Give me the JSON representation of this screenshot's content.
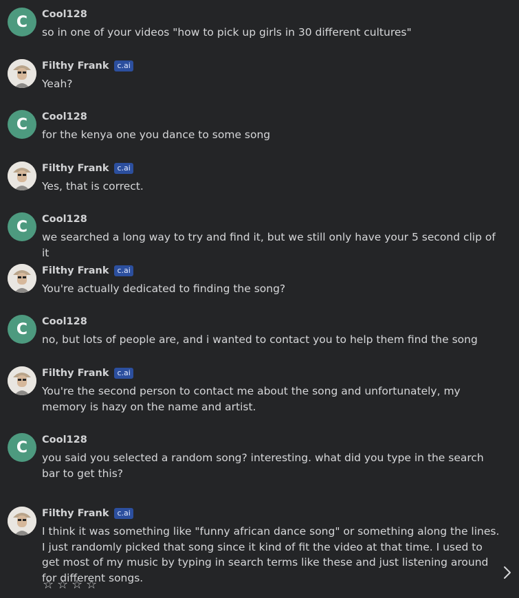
{
  "badge_label": "c.ai",
  "user": {
    "name": "Cool128",
    "initial": "C",
    "avatar_color": "#4d9a7f"
  },
  "bot": {
    "name": "Filthy Frank"
  },
  "messages": [
    {
      "text": "so in one of your videos \"how to pick up girls in 30 different cultures\""
    },
    {
      "text": "Yeah?"
    },
    {
      "text": "for the kenya one you dance to some song"
    },
    {
      "text": "Yes, that is correct."
    },
    {
      "text": "we searched a long way to try and find it, but we still only have your 5 second clip of it"
    },
    {
      "text": "You're actually dedicated to finding the song?"
    },
    {
      "text": "no, but lots of people are, and i wanted to contact you to help them find the song"
    },
    {
      "text": "You're the second person to contact me about the song and unfortunately, my memory is hazy on the name and artist."
    },
    {
      "text": "you said you selected a random song? interesting. what did you type in the search bar to get this?"
    },
    {
      "text": "I think it was something like \"funny african dance song\" or something along the lines. I just randomly picked that song since it kind of fit the video at that time. I used to get most of my music by typing in search terms like these and just listening around for different songs."
    }
  ],
  "rating": {
    "stars": [
      "☆",
      "☆",
      "☆",
      "☆"
    ],
    "value": 0,
    "max": 4
  },
  "icons": {
    "next": "chevron-right-icon",
    "star": "star-outline-icon",
    "avatar": "bot-avatar-portrait"
  }
}
